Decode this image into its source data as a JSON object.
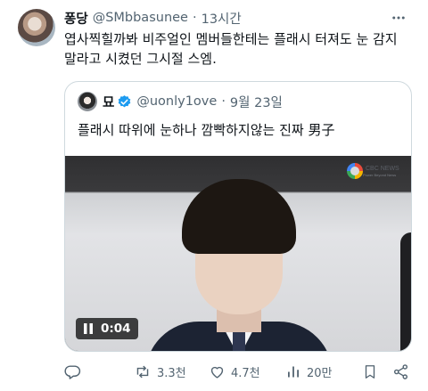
{
  "post": {
    "display_name": "퐁당",
    "handle": "@SMbbasunee",
    "separator": "·",
    "time": "13시간",
    "text": "엽사찍힐까봐 비주얼인 멤버들한테는  플래시 터져도 눈 감지 말라고 시켰던 그시절 스엠."
  },
  "quote": {
    "display_name": "묘",
    "handle": "@uonly1ove",
    "separator": "·",
    "time": "9월 23일",
    "text": "플래시 따위에 눈하나 깜빡하지않는 진짜 男子",
    "media": {
      "duration": "0:04",
      "watermark": "CBC NEWS",
      "watermark_sub": "Power Beyond News"
    }
  },
  "actions": {
    "reply_count": "",
    "retweet_count": "3.3천",
    "like_count": "4.7천",
    "views_count": "20만"
  },
  "colors": {
    "text_primary": "#0f1419",
    "text_secondary": "#536471",
    "verified": "#1d9bf0",
    "border": "#cfd9de"
  },
  "icons": {
    "more": "more-icon",
    "verified": "verified-icon",
    "pause": "pause-icon",
    "reply": "reply-icon",
    "retweet": "retweet-icon",
    "like": "like-icon",
    "views": "views-icon",
    "bookmark": "bookmark-icon",
    "share": "share-icon"
  }
}
